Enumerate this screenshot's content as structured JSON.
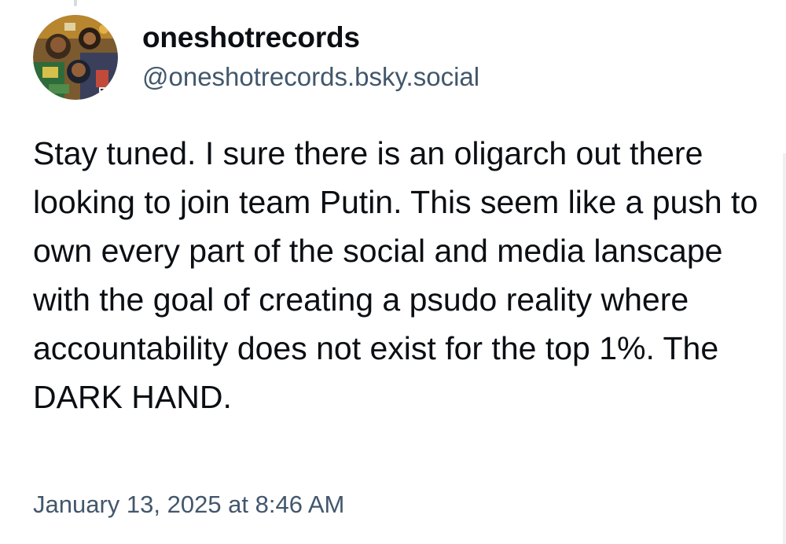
{
  "author": {
    "display_name": "oneshotrecords",
    "handle": "@oneshotrecords.bsky.social"
  },
  "post": {
    "text": "Stay tuned. I sure there is an oligarch out there looking to join team Putin. This seem like a push to own every part of the social and media lanscape with the goal of creating a psudo reality where accountability does not exist for the top 1%. The DARK HAND.",
    "timestamp": "January 13, 2025 at 8:46 AM"
  },
  "colors": {
    "text_primary": "#0b0f14",
    "text_secondary": "#42576c",
    "thread_line": "#d4dbe2"
  }
}
